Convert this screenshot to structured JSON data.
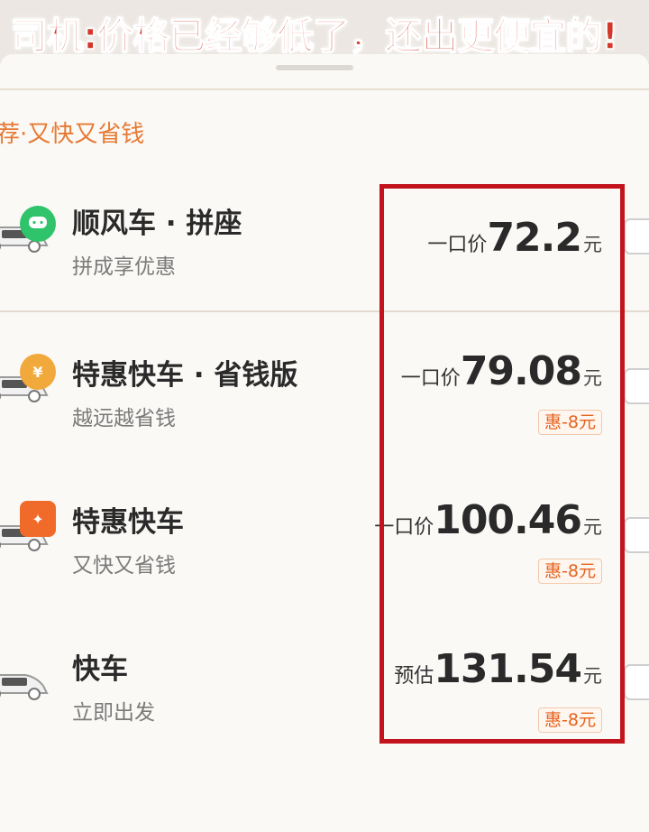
{
  "caption": "司机:价格已经够低了，还出更便宜的!",
  "section_title": "荐·又快又省钱",
  "options": [
    {
      "name": "顺风车 · 拼座",
      "subtitle": "拼成享优惠",
      "price_label": "一口价",
      "price": "72.2",
      "unit": "元",
      "discount": "",
      "badge_icon": "chat-bubble-icon",
      "badge_color": "#2fc46b"
    },
    {
      "name": "特惠快车 · 省钱版",
      "subtitle": "越远越省钱",
      "price_label": "一口价",
      "price": "79.08",
      "unit": "元",
      "discount": "惠-8元",
      "badge_icon": "yuan-coin-icon",
      "badge_color": "#f2a93b",
      "badge_glyph": "¥"
    },
    {
      "name": "特惠快车",
      "subtitle": "又快又省钱",
      "price_label": "一口价",
      "price": "100.46",
      "unit": "元",
      "discount": "惠-8元",
      "badge_icon": "lightning-badge-icon",
      "badge_color": "#f06a2a",
      "badge_glyph": "✦"
    },
    {
      "name": "快车",
      "subtitle": "立即出发",
      "price_label": "预估",
      "price": "131.54",
      "unit": "元",
      "discount": "惠-8元",
      "badge_icon": "",
      "badge_color": ""
    }
  ],
  "colors": {
    "highlight": "#c3131c",
    "accent": "#e67a34",
    "discount": "#e5631f"
  }
}
